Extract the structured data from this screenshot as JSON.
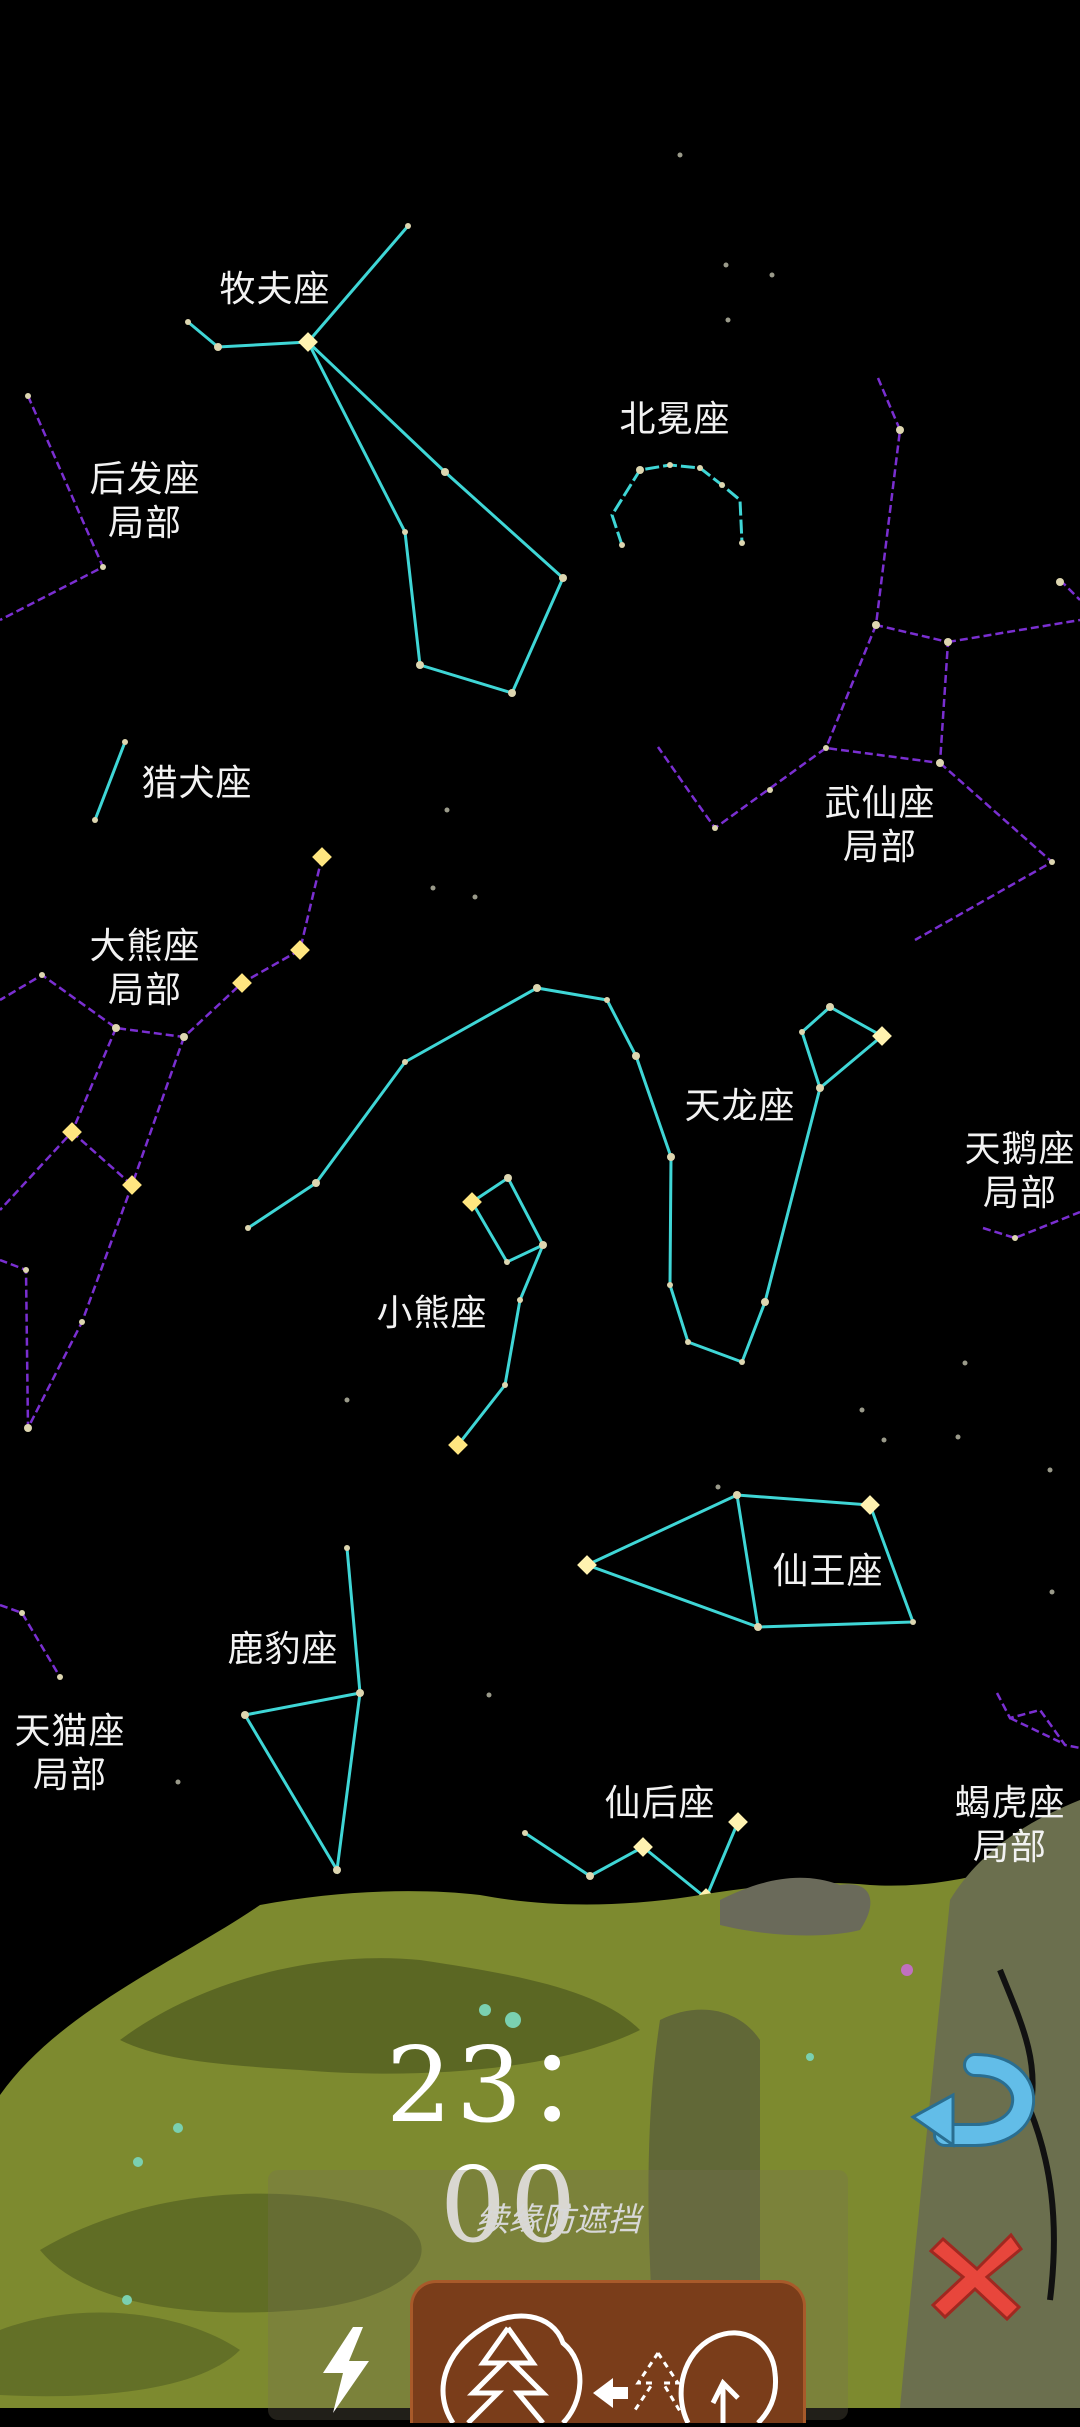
{
  "constellations": [
    {
      "id": "bootes",
      "label": "牧夫座"
    },
    {
      "id": "corona-borealis",
      "label": "北冕座"
    },
    {
      "id": "coma-berenices-partial",
      "label": "后发座\n局部"
    },
    {
      "id": "canes-venatici",
      "label": "猎犬座"
    },
    {
      "id": "cepheus-partial",
      "label": "武仙座\n局部"
    },
    {
      "id": "ursa-major-partial",
      "label": "大熊座\n局部"
    },
    {
      "id": "draco",
      "label": "天龙座"
    },
    {
      "id": "cygnus-partial",
      "label": "天鹅座\n局部"
    },
    {
      "id": "ursa-minor",
      "label": "小熊座"
    },
    {
      "id": "cepheus",
      "label": "仙王座"
    },
    {
      "id": "camelopardalis",
      "label": "鹿豹座"
    },
    {
      "id": "lynx-partial",
      "label": "天猫座\n局部"
    },
    {
      "id": "cassiopeia",
      "label": "仙后座"
    },
    {
      "id": "lacerta-partial",
      "label": "蝎虎座\n局部"
    }
  ],
  "time": "23：00",
  "hint": "续缘防遮挡",
  "buttons": {
    "return_icon": "return-arrow-icon",
    "close_icon": "close-x-icon",
    "lightning_icon": "lightning-icon",
    "tree_icon": "tree-swap-icon"
  },
  "colors": {
    "sky": "#000000",
    "main_line": "#3fd6d6",
    "partial_line": "#7a2fd1",
    "ground": "#7d8a2f",
    "return_arrow": "#57b8e8",
    "close_x": "#e8463c",
    "card": "#7a3d1a"
  }
}
